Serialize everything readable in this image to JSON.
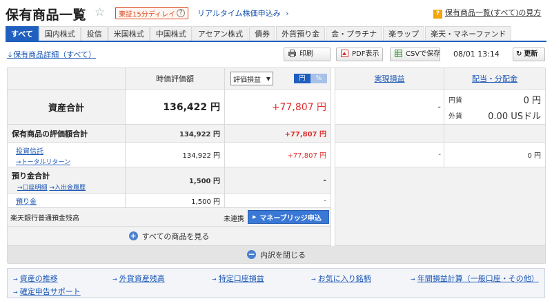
{
  "header": {
    "title": "保有商品一覧",
    "delay_badge": "東証15分ディレイ",
    "delay_help": "?",
    "realtime_link": "リアルタイム株価申込み",
    "help_link": "保有商品一覧(すべて)の見方",
    "help_icon": "?"
  },
  "tabs": [
    "すべて",
    "国内株式",
    "投信",
    "米国株式",
    "中国株式",
    "アセアン株式",
    "債券",
    "外貨預り金",
    "金・プラチナ",
    "楽ラップ",
    "楽天・マネーファンド"
  ],
  "toolbar": {
    "detail_link": "保有商品詳細（すべて）",
    "print_label": "印刷",
    "pdf_label": "PDF表示",
    "csv_label": "CSVで保存",
    "datetime": "08/01 13:14",
    "refresh_label": "更新"
  },
  "table": {
    "col_valuation": "時価評価額",
    "select_value": "評価損益",
    "toggle_yen": "円",
    "toggle_pct": "%",
    "col_realized": "実現損益",
    "col_dividend": "配当・分配金",
    "total_assets_label": "資産合計",
    "total_assets_value": "136,422 円",
    "total_assets_pl": "+77,807 円",
    "realized_total": "-",
    "dividend_yen_label": "円貨",
    "dividend_yen_value": "0 円",
    "dividend_fx_label": "外貨",
    "dividend_fx_value": "0.00 USドル",
    "holdings_label": "保有商品の評価額合計",
    "holdings_value": "134,922 円",
    "holdings_pl": "+77,807 円",
    "fund_label": "投資信託",
    "fund_link": "トータルリターン",
    "fund_value": "134,922 円",
    "fund_pl": "+77,807 円",
    "fund_realized": "-",
    "fund_dividend": "0 円",
    "deposit_label": "預り金合計",
    "deposit_link1": "口座明細",
    "deposit_link2": "入出金履歴",
    "deposit_value": "1,500 円",
    "deposit_pl": "-",
    "deposit_item_label": "預り金",
    "deposit_item_value": "1,500 円",
    "deposit_item_pl": "-",
    "bank_label": "楽天銀行普通預金残高",
    "bank_status": "未連携",
    "bank_button": "マネーブリッジ申込",
    "show_all": "すべての商品を見る",
    "close_breakdown": "内訳を閉じる"
  },
  "footer": {
    "links": [
      "資産の推移",
      "外貨資産残高",
      "特定口座損益",
      "お気に入り銘柄",
      "年間損益計算（一般口座・その他）",
      "確定申告サポート"
    ]
  },
  "colors": {
    "accent": "#1f5fbf",
    "profit": "#e02b2b",
    "link": "#1a56b3"
  }
}
